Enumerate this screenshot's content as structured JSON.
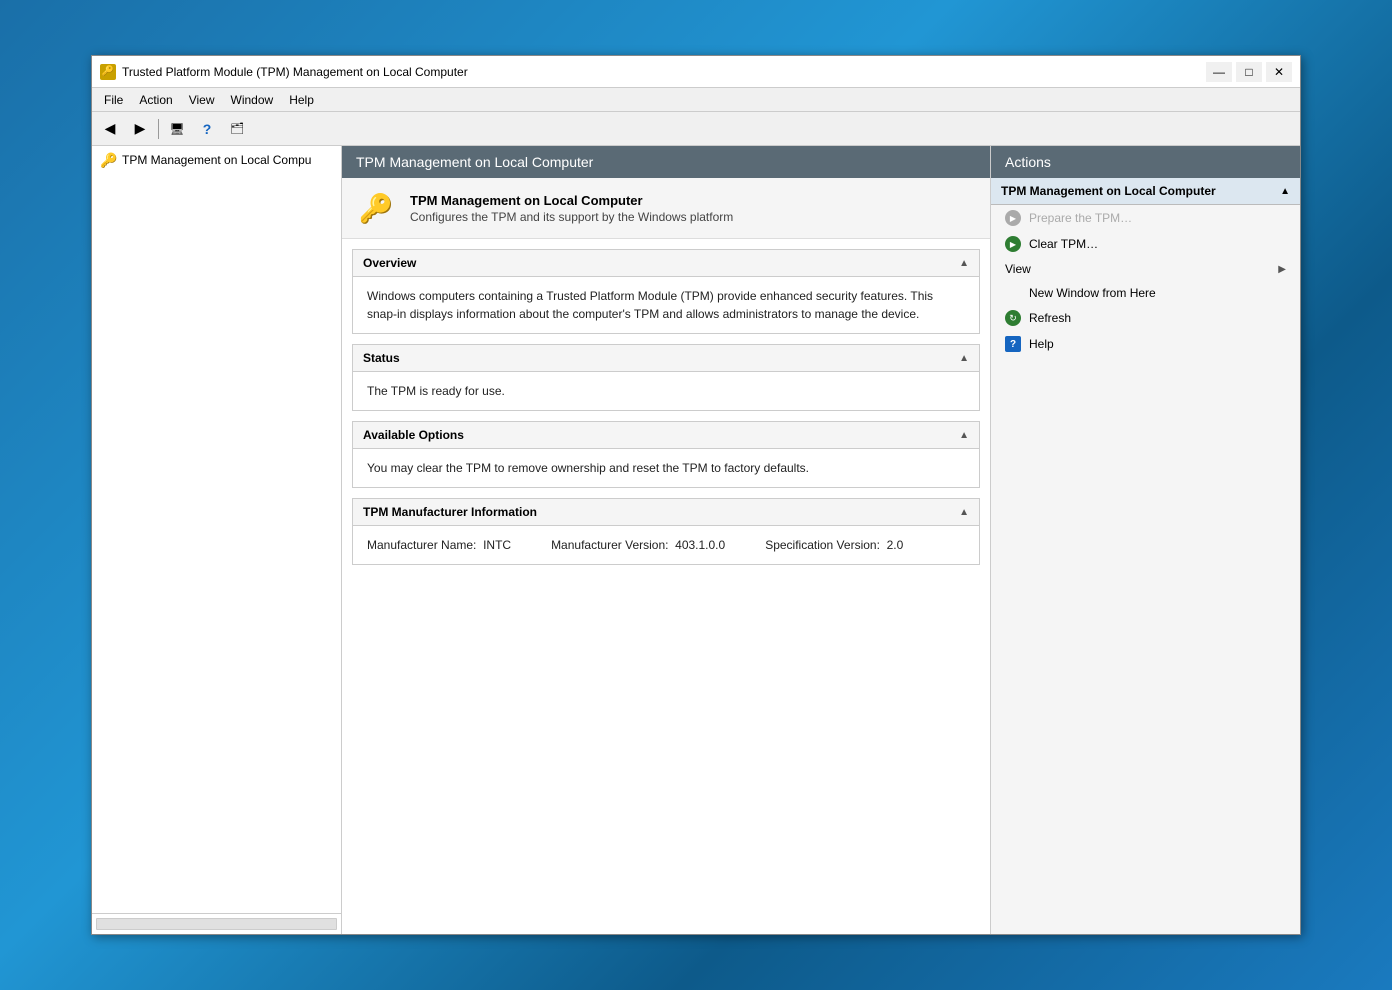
{
  "window": {
    "title": "Trusted Platform Module (TPM) Management on Local Computer",
    "icon": "🔑"
  },
  "title_bar": {
    "minimize": "—",
    "maximize": "□",
    "close": "✕"
  },
  "menu": {
    "items": [
      "File",
      "Action",
      "View",
      "Window",
      "Help"
    ]
  },
  "toolbar": {
    "back_tooltip": "Back",
    "forward_tooltip": "Forward",
    "up_tooltip": "Up one level",
    "help_tooltip": "Help",
    "show_tooltip": "Show/Hide"
  },
  "sidebar": {
    "item": "TPM Management on Local Compu"
  },
  "main": {
    "header": "TPM Management on Local Computer",
    "intro_title": "TPM Management on Local Computer",
    "intro_desc": "Configures the TPM and its support by the Windows platform",
    "sections": [
      {
        "title": "Overview",
        "body": "Windows computers containing a Trusted Platform Module (TPM) provide enhanced security features. This snap-in displays information about the computer's TPM and allows administrators to manage the device."
      },
      {
        "title": "Status",
        "body": "The TPM is ready for use."
      },
      {
        "title": "Available Options",
        "body": "You may clear the TPM to remove ownership and reset the TPM to factory defaults."
      },
      {
        "title": "TPM Manufacturer Information",
        "manufacturer_name_label": "Manufacturer Name:",
        "manufacturer_name_value": "INTC",
        "manufacturer_version_label": "Manufacturer Version:",
        "manufacturer_version_value": "403.1.0.0",
        "spec_version_label": "Specification Version:",
        "spec_version_value": "2.0"
      }
    ]
  },
  "actions": {
    "header": "Actions",
    "group_label": "TPM Management on Local Computer",
    "items": [
      {
        "label": "Prepare the TPM…",
        "type": "arrow",
        "disabled": true
      },
      {
        "label": "Clear TPM…",
        "type": "arrow",
        "disabled": false
      },
      {
        "label": "View",
        "type": "view",
        "has_submenu": true
      },
      {
        "label": "New Window from Here",
        "type": "plain",
        "indent": true
      },
      {
        "label": "Refresh",
        "type": "refresh"
      },
      {
        "label": "Help",
        "type": "help"
      }
    ]
  }
}
